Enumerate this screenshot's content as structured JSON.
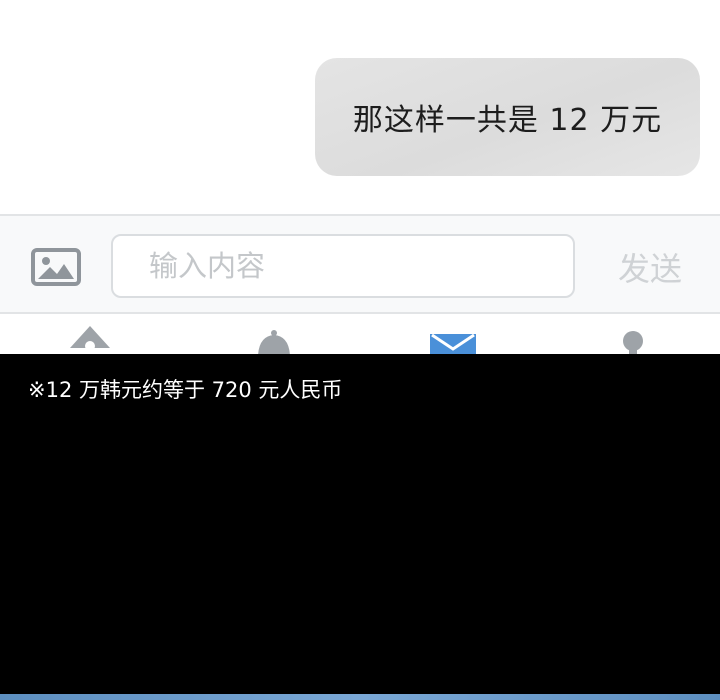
{
  "chat": {
    "message": "那这样一共是 12 万元"
  },
  "composer": {
    "image_icon": "image-icon",
    "input_placeholder": "输入内容",
    "send_label": "发送"
  },
  "nav": {
    "items": [
      {
        "icon": "home-icon"
      },
      {
        "icon": "bell-icon"
      },
      {
        "icon": "mail-icon"
      },
      {
        "icon": "person-icon"
      }
    ],
    "active_color": "#4a90d9",
    "inactive_color": "#9ea3a8"
  },
  "caption": {
    "text": "※12 万韩元约等于 720 元人民币"
  },
  "colors": {
    "bubble": "#e0e0e0",
    "caption_background": "#000000",
    "accent_strip": "#6f9fd0"
  }
}
